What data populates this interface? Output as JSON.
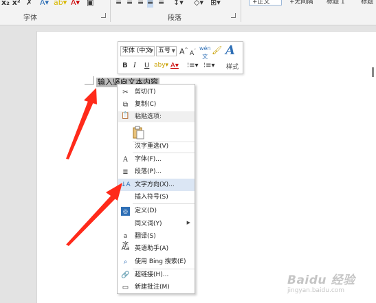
{
  "ribbon": {
    "font_group_label": "字体",
    "paragraph_group_label": "段落",
    "style_normal": "+正文",
    "style_no_spacing": "+无间隔",
    "style_heading1": "标题 1",
    "style_heading2": "标题"
  },
  "document": {
    "selected_text": "输入竖向文本内容"
  },
  "mini_toolbar": {
    "font_name": "宋体 (中文",
    "font_size": "五号",
    "styles_label": "样式"
  },
  "context_menu": {
    "cut": "剪切(T)",
    "copy": "复制(C)",
    "paste_options_header": "粘贴选项:",
    "reconvert": "汉字重选(V)",
    "font": "字体(F)...",
    "paragraph": "段落(P)...",
    "text_direction": "文字方向(X)...",
    "insert_symbol": "插入符号(S)",
    "define": "定义(D)",
    "synonyms": "同义词(Y)",
    "translate": "翻译(S)",
    "english_assistant": "英语助手(A)",
    "bing_search": "使用 Bing 搜索(E)",
    "hyperlink": "超链接(H)...",
    "new_comment": "新建批注(M)"
  },
  "watermark": {
    "brand": "Baidu 经验",
    "url": "jingyan.baidu.com"
  },
  "colors": {
    "highlight": "#dbe6f4",
    "arrow": "#ff2a1a",
    "selection": "#bdbdbd",
    "accent_blue": "#2e6fb6"
  }
}
